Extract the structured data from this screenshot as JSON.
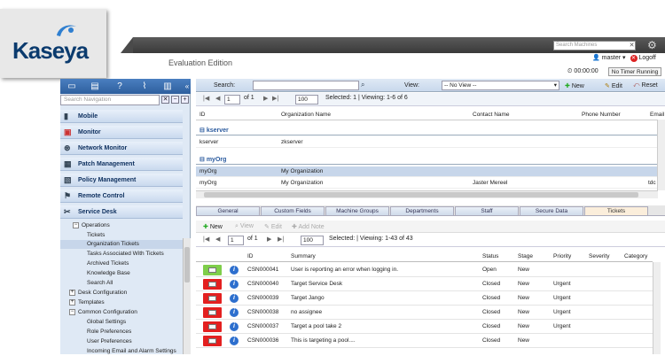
{
  "brand": {
    "logo": "Kaseya",
    "edition": "Evaluation Edition"
  },
  "topbar": {
    "search_placeholder": "Search Machines"
  },
  "user": {
    "name": "master",
    "logoff": "Logoff",
    "timer": "00:00:00",
    "timer_status": "No Timer Running"
  },
  "sidebar": {
    "search_placeholder": "Search Navigation",
    "modules": [
      "Mobile",
      "Monitor",
      "Network Monitor",
      "Patch Management",
      "Policy Management",
      "Remote Control",
      "Service Desk"
    ],
    "tree": [
      {
        "label": "Operations",
        "kind": "folder"
      },
      {
        "label": "Tickets",
        "kind": "leaf"
      },
      {
        "label": "Organization Tickets",
        "kind": "leaf",
        "selected": true
      },
      {
        "label": "Tasks Associated With Tickets",
        "kind": "leaf"
      },
      {
        "label": "Archived Tickets",
        "kind": "leaf"
      },
      {
        "label": "Knowledge Base",
        "kind": "leaf"
      },
      {
        "label": "Search All",
        "kind": "leaf"
      },
      {
        "label": "Desk Configuration",
        "kind": "folder-closed"
      },
      {
        "label": "Templates",
        "kind": "folder-closed"
      },
      {
        "label": "Common Configuration",
        "kind": "folder"
      },
      {
        "label": "Global Settings",
        "kind": "leaf"
      },
      {
        "label": "Role Preferences",
        "kind": "leaf"
      },
      {
        "label": "User Preferences",
        "kind": "leaf"
      },
      {
        "label": "Incoming Email and Alarm Settings",
        "kind": "leaf"
      }
    ]
  },
  "toolbar": {
    "search_label": "Search:",
    "view_label": "View:",
    "view_value": "-- No View --",
    "new": "New",
    "edit": "Edit",
    "reset": "Reset"
  },
  "orgpager": {
    "page": "1",
    "of": "of 1",
    "size": "100",
    "selected": "Selected:  1  |  Viewing:  1-6  of  6"
  },
  "orgtable": {
    "headers": [
      "ID",
      "Organization Name",
      "Contact Name",
      "Phone Number",
      "Email"
    ],
    "groups": [
      {
        "name": "kserver",
        "rows": [
          {
            "id": "kserver",
            "org": "zkserver",
            "contact": "",
            "phone": "",
            "email": ""
          }
        ]
      },
      {
        "name": "myOrg",
        "rows": [
          {
            "id": "myOrg",
            "org": "My Organization",
            "contact": "",
            "phone": "",
            "email": "",
            "selected": true
          },
          {
            "id": "myOrg",
            "org": "My Organization",
            "contact": "Jaster Mereel",
            "phone": "",
            "email": "tdc"
          }
        ]
      }
    ]
  },
  "tabs": [
    "General",
    "Custom Fields",
    "Machine Groups",
    "Departments",
    "Staff",
    "Secure Data",
    "Tickets"
  ],
  "tickettoolbar": {
    "new": "New",
    "view": "View",
    "edit": "Edit",
    "addnote": "Add Note"
  },
  "ticketpager": {
    "page": "1",
    "of": "of 1",
    "size": "100",
    "selected": "Selected:   |   Viewing:  1-43  of  43"
  },
  "tickets": {
    "headers": [
      "ID",
      "Summary",
      "Status",
      "Stage",
      "Priority",
      "Severity",
      "Category"
    ],
    "rows": [
      {
        "id": "CSN000041",
        "summary": "User is reporting an error when logging in.",
        "status": "Open",
        "stage": "New",
        "priority": "",
        "mail": "#7fce4a"
      },
      {
        "id": "CSN000040",
        "summary": "Target Service Desk",
        "status": "Closed",
        "stage": "New",
        "priority": "Urgent",
        "mail": "#e32020"
      },
      {
        "id": "CSN000039",
        "summary": "Target Jango",
        "status": "Closed",
        "stage": "New",
        "priority": "Urgent",
        "mail": "#e32020"
      },
      {
        "id": "CSN000038",
        "summary": "no assignee",
        "status": "Closed",
        "stage": "New",
        "priority": "Urgent",
        "mail": "#e32020"
      },
      {
        "id": "CSN000037",
        "summary": "Target a pool take 2",
        "status": "Closed",
        "stage": "New",
        "priority": "Urgent",
        "mail": "#e32020"
      },
      {
        "id": "CSN000036",
        "summary": "This is targeting a pool....",
        "status": "Closed",
        "stage": "New",
        "priority": "",
        "mail": "#e32020"
      }
    ]
  }
}
